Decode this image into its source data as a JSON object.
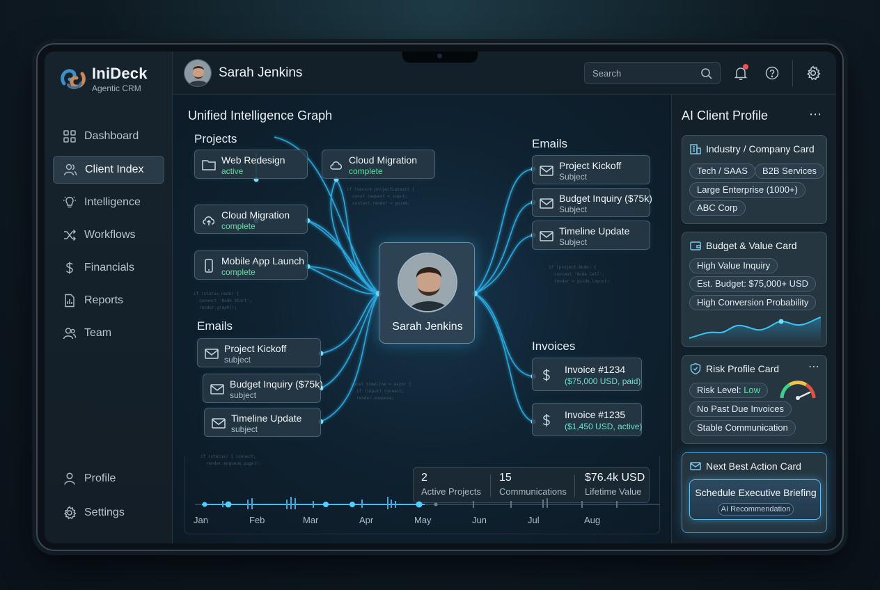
{
  "app": {
    "name": "IniDeck",
    "subtitle": "Agentic CRM"
  },
  "sidebar": {
    "items": [
      {
        "label": "Dashboard",
        "icon": "grid-icon",
        "active": false
      },
      {
        "label": "Client Index",
        "icon": "users-icon",
        "active": true
      },
      {
        "label": "Intelligence",
        "icon": "lightbulb-icon",
        "active": false
      },
      {
        "label": "Workflows",
        "icon": "shuffle-icon",
        "active": false
      },
      {
        "label": "Financials",
        "icon": "dollar-icon",
        "active": false
      },
      {
        "label": "Reports",
        "icon": "report-icon",
        "active": false
      },
      {
        "label": "Team",
        "icon": "team-icon",
        "active": false
      }
    ],
    "bottom": [
      {
        "label": "Profile",
        "icon": "user-icon"
      },
      {
        "label": "Settings",
        "icon": "gear-icon"
      }
    ]
  },
  "header": {
    "client_name": "Sarah Jenkins",
    "search_placeholder": "Search"
  },
  "graph": {
    "title": "Unified Intelligence Graph",
    "center_name": "Sarah Jenkins",
    "projects_label": "Projects",
    "projects": [
      {
        "title": "Web Redesign",
        "status": "active"
      },
      {
        "title": "Cloud Migration",
        "status": "complete"
      },
      {
        "title": "Cloud Migration",
        "status": "complete"
      },
      {
        "title": "Mobile App Launch",
        "status": "complete"
      }
    ],
    "emails_left_label": "Emails",
    "emails_left": [
      {
        "title": "Project Kickoff",
        "sub": "subject"
      },
      {
        "title": "Budget Inquiry ($75k)",
        "sub": "subject"
      },
      {
        "title": "Timeline Update",
        "sub": "subject"
      }
    ],
    "emails_right_label": "Emails",
    "emails_right": [
      {
        "title": "Project Kickoff",
        "sub": "Subject"
      },
      {
        "title": "Budget Inquiry ($75k)",
        "sub": "Subject"
      },
      {
        "title": "Timeline Update",
        "sub": "Subject"
      }
    ],
    "invoices_label": "Invoices",
    "invoices": [
      {
        "title": "Invoice #1234",
        "sub": "($75,000 USD, paid)"
      },
      {
        "title": "Invoice #1235",
        "sub": "($1,450 USD, active)"
      }
    ],
    "stats": [
      {
        "value": "2",
        "label": "Active Projects"
      },
      {
        "value": "15",
        "label": "Communications"
      },
      {
        "value": "$76.4k USD",
        "label": "Lifetime Value"
      }
    ],
    "timeline_months": [
      "Jan",
      "Feb",
      "Mar",
      "Apr",
      "May",
      "Jun",
      "Jul",
      "Aug"
    ]
  },
  "profile": {
    "title": "AI Client Profile",
    "industry_card": {
      "title": "Industry / Company Card",
      "chips": [
        "Tech / SAAS",
        "B2B Services",
        "Large Enterprise (1000+)",
        "ABC Corp"
      ]
    },
    "budget_card": {
      "title": "Budget & Value Card",
      "chips": [
        "High Value Inquiry",
        "Est. Budget: $75,000+ USD",
        "High Conversion Probability"
      ]
    },
    "risk_card": {
      "title": "Risk Profile Card",
      "risk_prefix": "Risk Level: ",
      "risk_value": "Low",
      "chips": [
        "No Past Due Invoices",
        "Stable Communication"
      ]
    },
    "nba_card": {
      "title": "Next Best Action Card",
      "action": "Schedule Executive Briefing",
      "badge": "AI Recommendation"
    }
  },
  "colors": {
    "accent": "#4fc3f7",
    "success": "#5ee0a0",
    "alert": "#ef5350"
  }
}
